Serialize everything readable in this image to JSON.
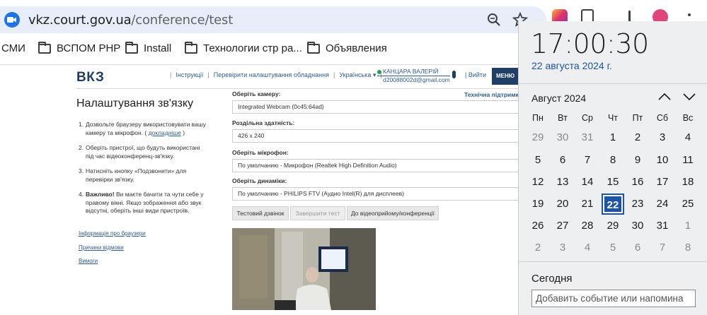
{
  "browser": {
    "url_host": "vkz.court.gov.ua",
    "url_path": "/conference/test",
    "bookmarks": [
      {
        "label": "СМИ",
        "folder": false
      },
      {
        "label": "ВСПОМ PHP",
        "folder": true
      },
      {
        "label": "Install",
        "folder": true
      },
      {
        "label": "Технологии стр ра...",
        "folder": true
      },
      {
        "label": "Объявления",
        "folder": true
      }
    ],
    "icons": [
      "zoom-icon",
      "star-icon",
      "extension-icon"
    ]
  },
  "site": {
    "logo": "ВКЗ",
    "nav": [
      "Інструкції",
      "Перевірити налаштування обладнання",
      "Українська ▾"
    ],
    "user_name": "КАНЦАРА ВАЛЕРІЙ",
    "user_email": "d20088002d@gmail.com",
    "exit_label": "Вийти",
    "menu_label": "МЕНЮ",
    "section_title": "Налаштування зв'язку",
    "steps": [
      {
        "num": "1.",
        "text": "Дозвольте браузеру використовувати вашу камеру та мікрофон. (",
        "link": "докладніше",
        "after": ")"
      },
      {
        "num": "2.",
        "text": "Оберіть пристрої, що будуть використані під час відеоконференц-зв'язку."
      },
      {
        "num": "3.",
        "text": "Натисніть кнопку «Подзвонити» для перевірки зв'язку."
      },
      {
        "num": "4.",
        "bold": "Важливо!",
        "text": " Ви маєте бачити та чути себе у правому вікні. Якщо зображення або звук відсутні, оберіть інші види пристроїв."
      }
    ],
    "side_links": [
      "Інформація про браузери",
      "Причини відмови",
      "Вимоги"
    ],
    "tech_support": "Технічна підтримк",
    "fields": [
      {
        "label": "Оберіть камеру:",
        "value": "Integrated Webcam (0c45:64ad)"
      },
      {
        "label": "Роздільна здатність:",
        "value": "426 x 240"
      },
      {
        "label": "Оберіть мікрофон:",
        "value": "По умолчанию - Микрофон (Realtek High Definition Audio)"
      },
      {
        "label": "Оберіть динаміки:",
        "value": "По умолчанию - PHILIPS FTV (Аудио Intel(R) для дисплеев)"
      }
    ],
    "buttons": {
      "test_call": "Тестовий дзвінок",
      "end_test": "Завершити тест",
      "to_conference": "До відеоприйому/конференції"
    }
  },
  "calendar": {
    "time": "17:00:30",
    "date": "22 августа 2024 г.",
    "month": "Август 2024",
    "weekdays": [
      "Пн",
      "Вт",
      "Ср",
      "Чт",
      "Пт",
      "Сб",
      "Вс"
    ],
    "weeks": [
      [
        "29",
        "30",
        "31",
        "1",
        "2",
        "3",
        "4"
      ],
      [
        "5",
        "6",
        "7",
        "8",
        "9",
        "10",
        "11"
      ],
      [
        "12",
        "13",
        "14",
        "15",
        "16",
        "17",
        "18"
      ],
      [
        "19",
        "20",
        "21",
        "22",
        "23",
        "24",
        "25"
      ],
      [
        "26",
        "27",
        "28",
        "29",
        "30",
        "31",
        "1"
      ],
      [
        "2",
        "3",
        "4",
        "5",
        "6",
        "7",
        "8"
      ]
    ],
    "today_day": "22",
    "today_label": "Сегодня",
    "event_placeholder": "Добавить событие или напомина"
  },
  "colors": {
    "accent": "#1c54a7",
    "site_navy": "#1f3f66",
    "link": "#2d5e93"
  }
}
